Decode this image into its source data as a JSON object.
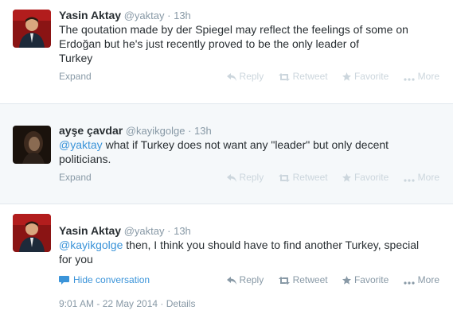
{
  "colors": {
    "link": "#3b94d9",
    "muted": "#8899a6",
    "faded": "#ccd6dd",
    "text": "#292f33"
  },
  "separator": "·",
  "tweets": [
    {
      "fullname": "Yasin Aktay",
      "handle": "@yaktay",
      "time": "13h",
      "text_lines": [
        "The qoutation made by der Spiegel may reflect the feelings of some on",
        "Erdoğan but he's just recently proved to be the only leader of",
        "Turkey"
      ],
      "expand": "Expand",
      "actions": [
        "Reply",
        "Retweet",
        "Favorite",
        "More"
      ]
    },
    {
      "fullname": "ayşe çavdar",
      "handle": "@kayikgolge",
      "time": "13h",
      "mention": "@yaktay",
      "text_lines": [
        " what if Turkey does not want any \"leader\" but only decent",
        "politicians."
      ],
      "expand": "Expand",
      "actions": [
        "Reply",
        "Retweet",
        "Favorite",
        "More"
      ]
    },
    {
      "fullname": "Yasin Aktay",
      "handle": "@yaktay",
      "time": "13h",
      "mention": "@kayikgolge",
      "text_lines": [
        " then, I think you should have to find another Turkey, special",
        "for you"
      ],
      "hide_conversation": "Hide conversation",
      "actions": [
        "Reply",
        "Retweet",
        "Favorite",
        "More"
      ],
      "timestamp": "9:01 AM - 22 May 2014",
      "details": "Details"
    }
  ]
}
